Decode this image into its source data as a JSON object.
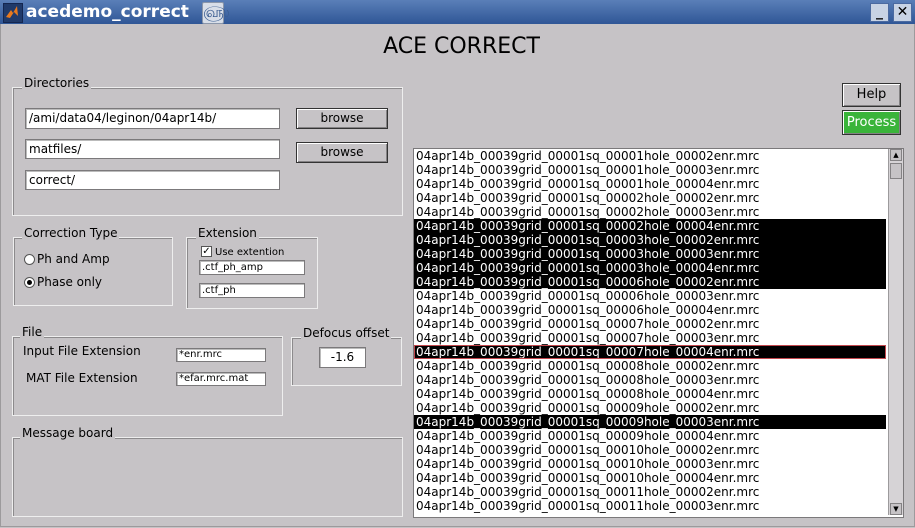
{
  "window": {
    "title": "acedemo_correct",
    "min_glyph": "_",
    "close_glyph": "✕",
    "swirl_glyph": "௵"
  },
  "header": {
    "title": "ACE CORRECT"
  },
  "directories": {
    "legend": "Directories",
    "dir1": "/ami/data04/leginon/04apr14b/",
    "dir2": "matfiles/",
    "dir3": "correct/",
    "browse1": "browse",
    "browse2": "browse"
  },
  "correction_type": {
    "legend": "Correction Type",
    "options": [
      {
        "label": "Ph and Amp",
        "checked": false
      },
      {
        "label": "Phase only",
        "checked": true
      }
    ]
  },
  "extension": {
    "legend": "Extension",
    "use_label": "Use extention",
    "use_checked": true,
    "ext1": ".ctf_ph_amp",
    "ext2": ".ctf_ph"
  },
  "file": {
    "legend": "File",
    "input_label": "Input File Extension",
    "input_value": "*enr.mrc",
    "mat_label": "MAT File Extension",
    "mat_value": "*efar.mrc.mat"
  },
  "defocus": {
    "legend": "Defocus offset",
    "value": "-1.6"
  },
  "message_board": {
    "legend": "Message board"
  },
  "actions": {
    "help": "Help",
    "process": "Process"
  },
  "file_list": {
    "items": [
      {
        "name": "04apr14b_00039grid_00001sq_00001hole_00002enr.mrc",
        "selected": false
      },
      {
        "name": "04apr14b_00039grid_00001sq_00001hole_00003enr.mrc",
        "selected": false
      },
      {
        "name": "04apr14b_00039grid_00001sq_00001hole_00004enr.mrc",
        "selected": false
      },
      {
        "name": "04apr14b_00039grid_00001sq_00002hole_00002enr.mrc",
        "selected": false
      },
      {
        "name": "04apr14b_00039grid_00001sq_00002hole_00003enr.mrc",
        "selected": false
      },
      {
        "name": "04apr14b_00039grid_00001sq_00002hole_00004enr.mrc",
        "selected": true
      },
      {
        "name": "04apr14b_00039grid_00001sq_00003hole_00002enr.mrc",
        "selected": true
      },
      {
        "name": "04apr14b_00039grid_00001sq_00003hole_00003enr.mrc",
        "selected": true
      },
      {
        "name": "04apr14b_00039grid_00001sq_00003hole_00004enr.mrc",
        "selected": true
      },
      {
        "name": "04apr14b_00039grid_00001sq_00006hole_00002enr.mrc",
        "selected": true
      },
      {
        "name": "04apr14b_00039grid_00001sq_00006hole_00003enr.mrc",
        "selected": false
      },
      {
        "name": "04apr14b_00039grid_00001sq_00006hole_00004enr.mrc",
        "selected": false
      },
      {
        "name": "04apr14b_00039grid_00001sq_00007hole_00002enr.mrc",
        "selected": false
      },
      {
        "name": "04apr14b_00039grid_00001sq_00007hole_00003enr.mrc",
        "selected": false
      },
      {
        "name": "04apr14b_00039grid_00001sq_00007hole_00004enr.mrc",
        "selected": true,
        "focused": true
      },
      {
        "name": "04apr14b_00039grid_00001sq_00008hole_00002enr.mrc",
        "selected": false
      },
      {
        "name": "04apr14b_00039grid_00001sq_00008hole_00003enr.mrc",
        "selected": false
      },
      {
        "name": "04apr14b_00039grid_00001sq_00008hole_00004enr.mrc",
        "selected": false
      },
      {
        "name": "04apr14b_00039grid_00001sq_00009hole_00002enr.mrc",
        "selected": false
      },
      {
        "name": "04apr14b_00039grid_00001sq_00009hole_00003enr.mrc",
        "selected": true
      },
      {
        "name": "04apr14b_00039grid_00001sq_00009hole_00004enr.mrc",
        "selected": false
      },
      {
        "name": "04apr14b_00039grid_00001sq_00010hole_00002enr.mrc",
        "selected": false
      },
      {
        "name": "04apr14b_00039grid_00001sq_00010hole_00003enr.mrc",
        "selected": false
      },
      {
        "name": "04apr14b_00039grid_00001sq_00010hole_00004enr.mrc",
        "selected": false
      },
      {
        "name": "04apr14b_00039grid_00001sq_00011hole_00002enr.mrc",
        "selected": false
      },
      {
        "name": "04apr14b_00039grid_00001sq_00011hole_00003enr.mrc",
        "selected": false
      }
    ]
  },
  "colors": {
    "process_green": "#3ab43a",
    "selection": "#000000",
    "titlebar": "#2f5696"
  }
}
